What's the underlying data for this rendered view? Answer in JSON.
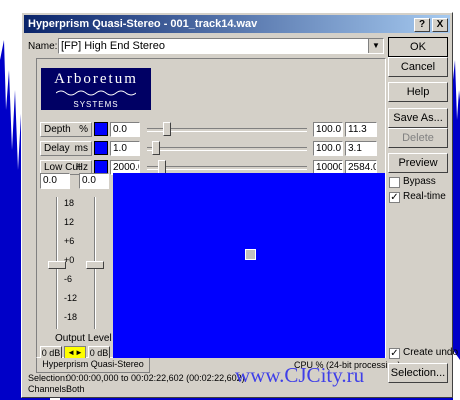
{
  "window": {
    "title": "Hyperprism Quasi-Stereo - 001_track14.wav"
  },
  "titlebar_buttons": {
    "help": "?",
    "close": "X"
  },
  "name_row": {
    "label": "Name:",
    "value": "[FP] High End Stereo"
  },
  "logo": {
    "brand": "Arboretum",
    "sub": "SYSTEMS"
  },
  "params": [
    {
      "name": "Depth",
      "unit": "%",
      "min": "0.0",
      "max": "100.0",
      "value": "11.3"
    },
    {
      "name": "Delay",
      "unit": "ms",
      "min": "1.0",
      "max": "100.0",
      "value": "3.1"
    },
    {
      "name": "Low Cut",
      "unit": "Hz",
      "min": "2000.0",
      "max": "10000.",
      "value": "2584.0"
    }
  ],
  "meter": {
    "left_value": "0.0",
    "right_value": "0.0",
    "scale": [
      "18",
      "12",
      "+6",
      "+0",
      "-6",
      "-12",
      "-18"
    ],
    "output_level_label": "Output Level",
    "left_db": "0 dB",
    "right_db": "0 dB"
  },
  "pad": {
    "background": "#0000ff"
  },
  "status": {
    "plugin_name": "Hyperprism  Quasi-Stereo",
    "cpu": "CPU %  (24-bit processing)"
  },
  "bottom": {
    "selection_label": "Selection:",
    "selection_value": "00:00:00,000 to 00:02:22,602 (00:02:22,602)",
    "channels_label": "Channels:",
    "channels_value": "Both"
  },
  "buttons": {
    "ok": "OK",
    "cancel": "Cancel",
    "help": "Help",
    "save_as": "Save As...",
    "delete": "Delete",
    "preview": "Preview",
    "selection": "Selection..."
  },
  "options": {
    "bypass": "Bypass",
    "realtime": "Real-time",
    "create_undo": "Create undo"
  },
  "watermark": "www.CJCity.ru",
  "colors": {
    "watermark": "#3f3fe8",
    "accent": "#0000ff",
    "waveform": "#0000c0"
  }
}
